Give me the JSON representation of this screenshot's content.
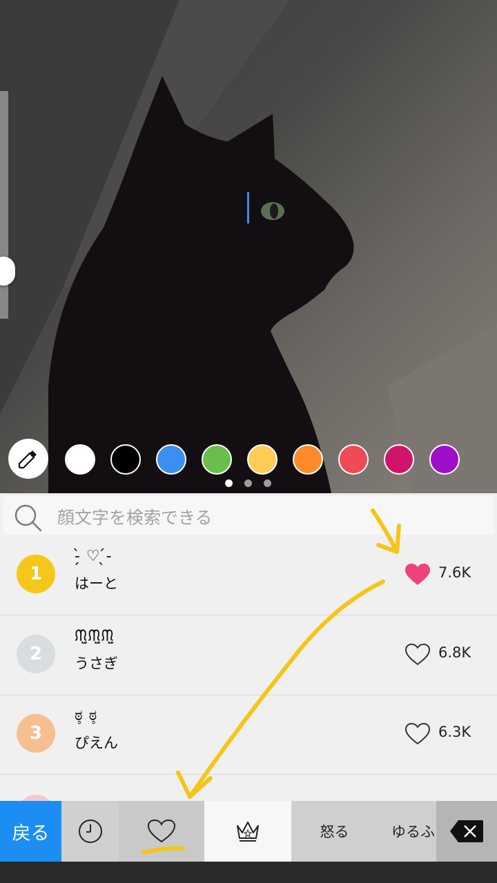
{
  "palette": {
    "colors": [
      "#ffffff",
      "#000000",
      "#3b8ff0",
      "#6abf4b",
      "#ffcc55",
      "#ff8b2a",
      "#ee4b55",
      "#d0146a",
      "#a00fc8"
    ],
    "active_page": 1,
    "page_count": 3
  },
  "search": {
    "placeholder": "顔文字を検索できる"
  },
  "ranking": [
    {
      "rank": "1",
      "rank_color": "#f5c71a",
      "kaomoji": "-̗̀ ♡ ̖́-",
      "name": "はーと",
      "count": "7.6K",
      "liked": true
    },
    {
      "rank": "2",
      "rank_color": "#d8dde0",
      "kaomoji": "ᙏ̤̫ᙏ̤̫ᙏ̤̫",
      "name": "うさぎ",
      "count": "6.8K",
      "liked": false
    },
    {
      "rank": "3",
      "rank_color": "#f6bf92",
      "kaomoji": "ಠ̥ ಠ̥",
      "name": "ぴえん",
      "count": "6.3K",
      "liked": false
    }
  ],
  "tabs": {
    "back": "戻る",
    "recent": "clock-icon",
    "favorites": "heart-icon",
    "popular": "crown-icon",
    "angry": "怒る",
    "loose": "ゆるふ",
    "delete": "backspace-icon"
  },
  "colors": {
    "accent": "#1c8ef3",
    "liked_heart": "#f0437a",
    "annotation": "#f5c518"
  }
}
